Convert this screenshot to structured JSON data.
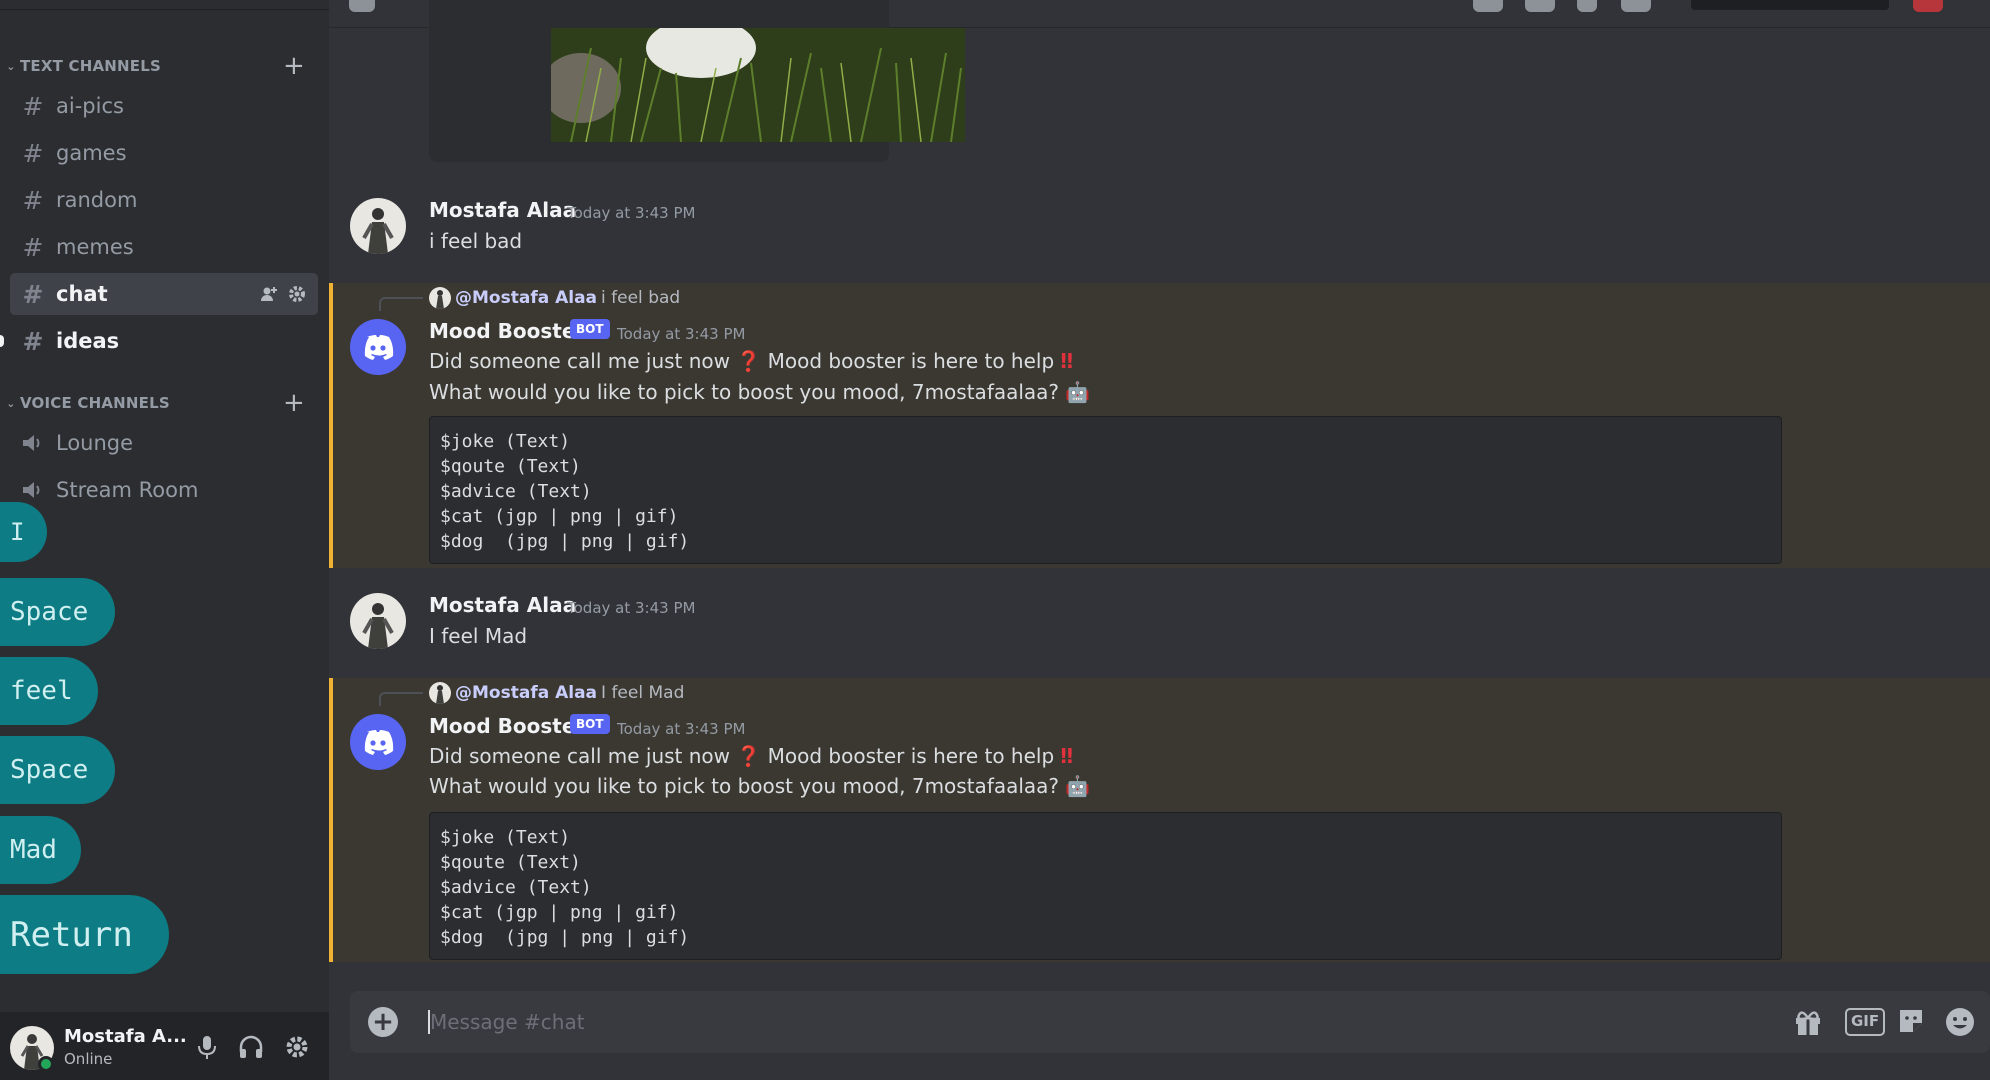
{
  "sidebar": {
    "text_category": "TEXT CHANNELS",
    "voice_category": "VOICE CHANNELS",
    "text_channels": [
      "ai-pics",
      "games",
      "random",
      "memes",
      "chat",
      "ideas"
    ],
    "voice_channels": [
      "Lounge",
      "Stream Room"
    ]
  },
  "keys": [
    "I",
    "Space",
    "feel",
    "Space",
    "Mad",
    "Return"
  ],
  "user_panel": {
    "name": "Mostafa A...",
    "status": "Online"
  },
  "messages": [
    {
      "author": "Mostafa Alaa",
      "time": "Today at 3:43 PM",
      "text": "i feel bad"
    },
    {
      "reply_mention": "@Mostafa Alaa",
      "reply_text": "i feel bad",
      "author": "Mood Booster",
      "badge": "BOT",
      "time": "Today at 3:43 PM",
      "line1a": "Did someone call me just now",
      "line1b": "Mood booster is here to help",
      "line2": "What would you like to pick to boost you mood, 7mostafaalaa?",
      "code": "$joke (Text)\n$qoute (Text)\n$advice (Text)\n$cat (jgp | png | gif)\n$dog  (jpg | png | gif)"
    },
    {
      "author": "Mostafa Alaa",
      "time": "Today at 3:43 PM",
      "text": "I feel Mad"
    },
    {
      "reply_mention": "@Mostafa Alaa",
      "reply_text": "I feel Mad",
      "author": "Mood Booster",
      "badge": "BOT",
      "time": "Today at 3:43 PM",
      "line1a": "Did someone call me just now",
      "line1b": "Mood booster is here to help",
      "line2": "What would you like to pick to boost you mood, 7mostafaalaa?",
      "code": "$joke (Text)\n$qoute (Text)\n$advice (Text)\n$cat (jgp | png | gif)\n$dog  (jpg | png | gif)"
    }
  ],
  "composer": {
    "placeholder": "Message #chat",
    "gif_label": "GIF"
  },
  "colors": {
    "accent": "#5865f2",
    "highlight_bar": "#f0b232",
    "key_bg": "#0d7c84",
    "online": "#23a55a"
  },
  "icons": [
    "hash-icon",
    "speaker-icon",
    "plus-icon",
    "add-member-icon",
    "gear-icon",
    "mic-icon",
    "headphones-icon",
    "gift-icon",
    "sticker-icon",
    "emoji-icon",
    "discord-bot-icon"
  ]
}
